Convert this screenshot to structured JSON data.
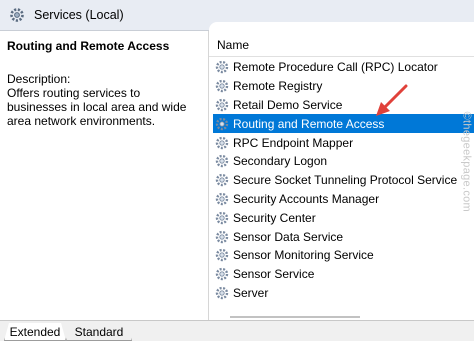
{
  "window": {
    "title": "Services (Local)"
  },
  "details": {
    "service_name": "Routing and Remote Access",
    "description_label": "Description:",
    "description": "Offers routing services to businesses in local area and wide area network environments."
  },
  "list": {
    "column_header": "Name",
    "selected_index": 3,
    "items": [
      {
        "label": "Remote Procedure Call (RPC) Locator"
      },
      {
        "label": "Remote Registry"
      },
      {
        "label": "Retail Demo Service"
      },
      {
        "label": "Routing and Remote Access"
      },
      {
        "label": "RPC Endpoint Mapper"
      },
      {
        "label": "Secondary Logon"
      },
      {
        "label": "Secure Socket Tunneling Protocol Service"
      },
      {
        "label": "Security Accounts Manager"
      },
      {
        "label": "Security Center"
      },
      {
        "label": "Sensor Data Service"
      },
      {
        "label": "Sensor Monitoring Service"
      },
      {
        "label": "Sensor Service"
      },
      {
        "label": "Server"
      }
    ]
  },
  "tabs": {
    "extended": "Extended",
    "standard": "Standard",
    "active": "extended"
  },
  "watermark": "©thegeekpage.com",
  "colors": {
    "selection": "#0078d7",
    "arrow": "#e0413a",
    "titlebar": "#e8ecf3"
  }
}
